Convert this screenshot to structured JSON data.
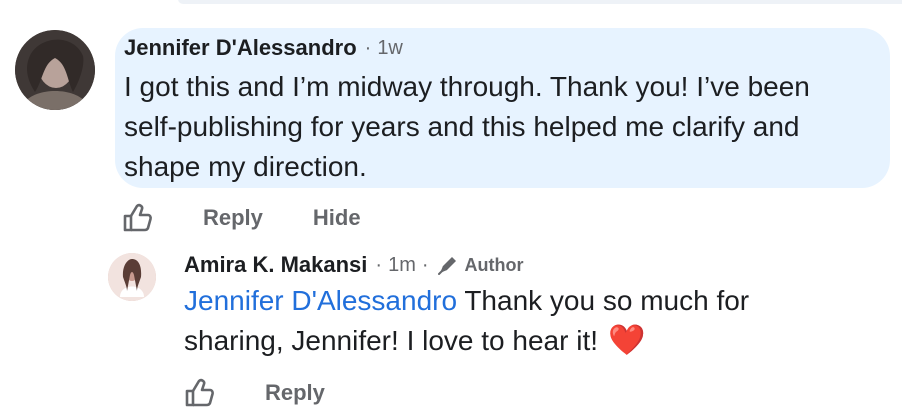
{
  "comments": [
    {
      "author": "Jennifer D'Alessandro",
      "separator": "·",
      "time": "1w",
      "text_line1": "I got this and I’m midway through. Thank you! I’ve been",
      "text_line2": "self-publishing for years and this helped me clarify and",
      "text_line3": "shape my direction.",
      "actions": {
        "reply": "Reply",
        "hide": "Hide"
      }
    }
  ],
  "reply": {
    "author": "Amira K. Makansi",
    "separator": "·",
    "time": "1m",
    "separator2": "·",
    "badge": "Author",
    "mention": "Jennifer D'Alessandro",
    "text_rest1": " Thank you so much for",
    "text_line2": "sharing, Jennifer! I love to hear it!",
    "emoji": "❤️",
    "actions": {
      "reply": "Reply"
    }
  },
  "icons": {
    "like": "thumbs-up-outline-icon",
    "author_badge": "pencil-icon",
    "avatar_1": "avatar",
    "avatar_2": "avatar"
  }
}
